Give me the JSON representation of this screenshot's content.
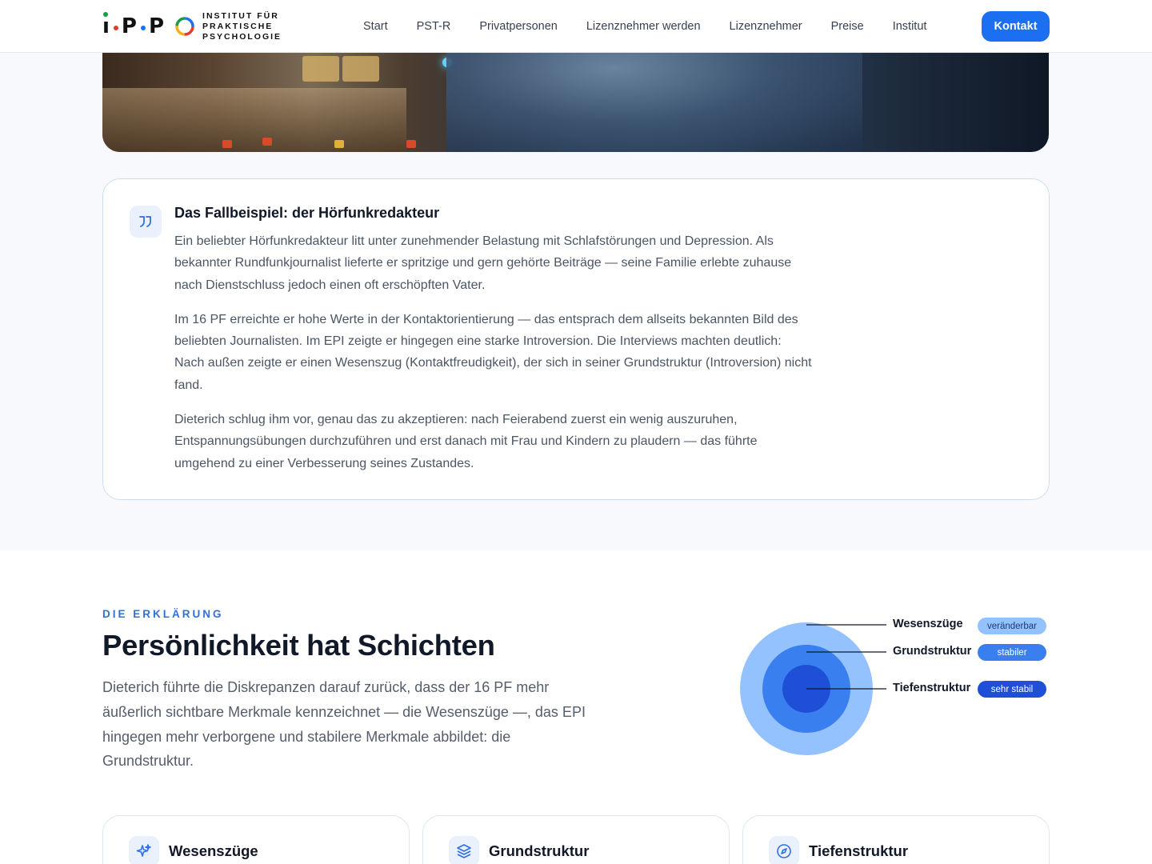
{
  "brand": {
    "logo_letters": "i·P·P",
    "logo_text": [
      "INSTITUT FÜR",
      "PRAKTISCHE",
      "PSYCHOLOGIE"
    ],
    "accent": "#1d6ff2"
  },
  "nav": {
    "items": [
      "Start",
      "PST-R",
      "Privatpersonen",
      "Lizenznehmer werden",
      "Lizenznehmer",
      "Preise",
      "Institut"
    ],
    "cta": "Kontakt"
  },
  "case": {
    "icon": "quote-icon",
    "title": "Das Fallbeispiel: der Hörfunkredakteur",
    "paragraphs": [
      "Ein beliebter Hörfunkredakteur litt unter zunehmender Belastung mit Schlafstörungen und Depression. Als bekannter Rundfunkjournalist lieferte er spritzige und gern gehörte Beiträge — seine Familie erlebte zuhause nach Dienstschluss jedoch einen oft erschöpften Vater.",
      "Im 16 PF erreichte er hohe Werte in der Kontaktorientierung — das entsprach dem allseits bekannten Bild des beliebten Journalisten. Im EPI zeigte er hingegen eine starke Introversion. Die Interviews machten deutlich: Nach außen zeigte er einen Wesenszug (Kontaktfreudigkeit), der sich in seiner Grundstruktur (Introversion) nicht fand.",
      "Dieterich schlug ihm vor, genau das zu akzeptieren: nach Feierabend zuerst ein wenig auszuruhen, Entspannungsübungen durchzuführen und erst danach mit Frau und Kindern zu plaudern — das führte umgehend zu einer Verbesserung seines Zustandes."
    ]
  },
  "explanation": {
    "eyebrow": "DIE ERKLÄRUNG",
    "headline": "Persönlichkeit hat Schichten",
    "lead": "Dieterich führte die Diskrepanzen darauf zurück, dass der 16 PF mehr äußerlich sichtbare Merkmale kennzeichnet — die Wesenszüge —, das EPI hingegen mehr verborgene und stabilere Merkmale abbildet: die Grundstruktur."
  },
  "layers": [
    {
      "name": "Wesenszüge",
      "badge": "veränderbar",
      "color": "#93c2ff"
    },
    {
      "name": "Grundstruktur",
      "badge": "stabiler",
      "color": "#3a7fef"
    },
    {
      "name": "Tiefenstruktur",
      "badge": "sehr stabil",
      "color": "#1e4fd6"
    }
  ],
  "cards": [
    {
      "icon": "sparkle-icon",
      "title": "Wesenszüge"
    },
    {
      "icon": "layers-icon",
      "title": "Grundstruktur"
    },
    {
      "icon": "compass-icon",
      "title": "Tiefenstruktur"
    }
  ]
}
